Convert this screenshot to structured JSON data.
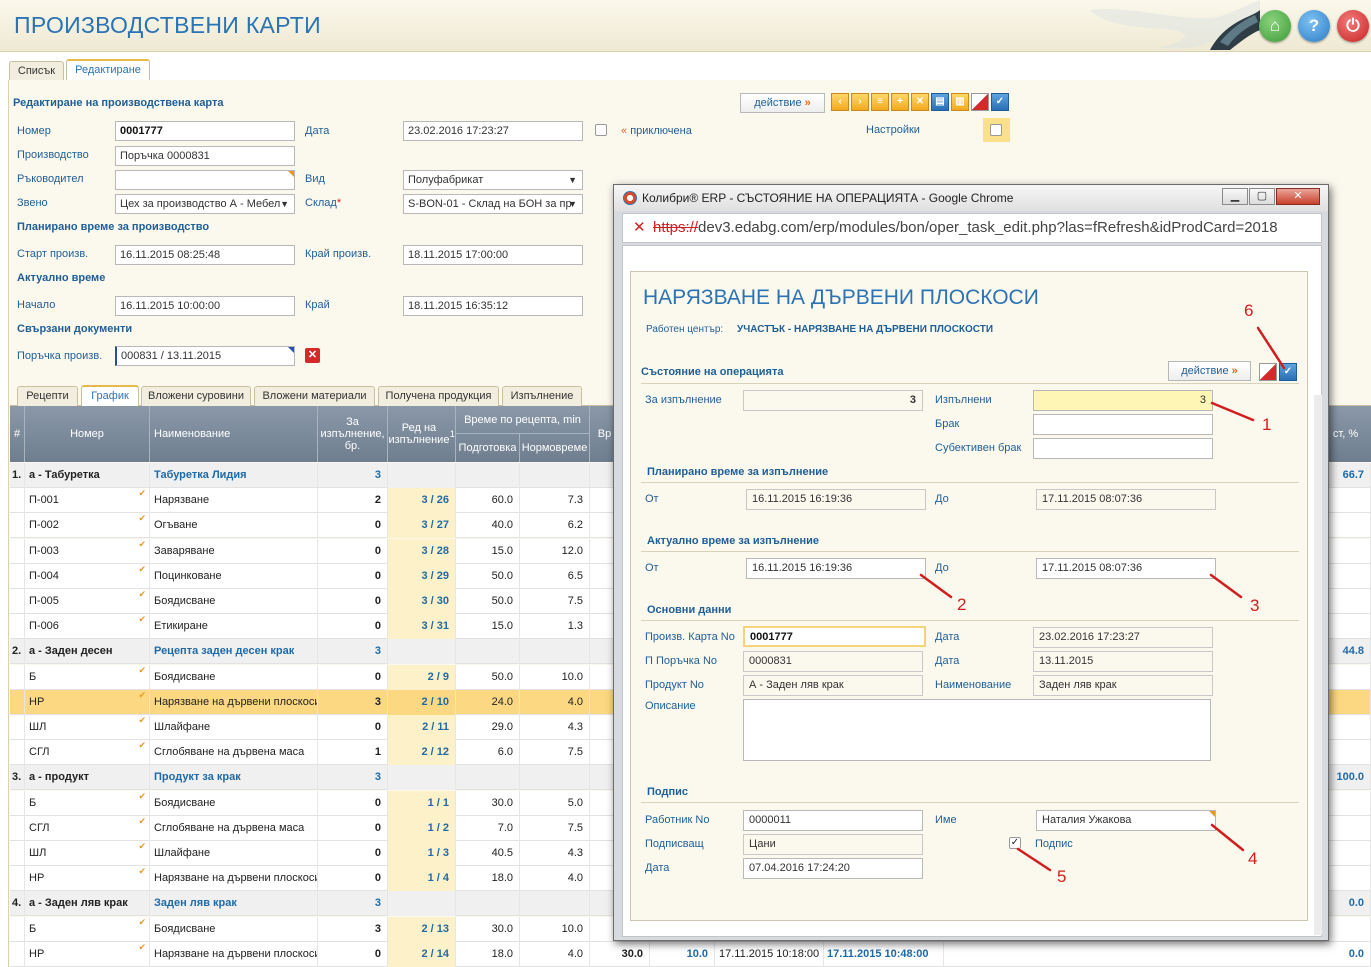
{
  "app": {
    "title": "ПРОИЗВОДСТВЕНИ КАРТИ",
    "header_buttons": [
      "home-icon",
      "help-icon",
      "power-icon"
    ]
  },
  "tabs": [
    "Списък",
    "Редактиране"
  ],
  "form": {
    "section_title": "Редактиране на производствена карта",
    "action_label": "действие",
    "number_label": "Номер",
    "number_value": "0001777",
    "date_label": "Дата",
    "date_value": "23.02.2016 17:23:27",
    "closed_label": "приключена",
    "settings_label": "Настройки",
    "production_label": "Производство",
    "production_value": "Поръчка 0000831",
    "manager_label": "Ръководител",
    "manager_value": "",
    "type_label": "Вид",
    "type_value": "Полуфабрикат",
    "unit_label": "Звено",
    "unit_value": "Цех за производство А - Мебел",
    "warehouse_label": "Склад",
    "warehouse_value": "S-BON-01 - Склад на БОН за пр",
    "planned_title": "Планирано време за производство",
    "start_label": "Старт произв.",
    "start_value": "16.11.2015 08:25:48",
    "end_label": "Край произв.",
    "end_value": "18.11.2015 17:00:00",
    "actual_title": "Актуално време",
    "begin_label": "Начало",
    "begin_value": "16.11.2015 10:00:00",
    "finish_label": "Край",
    "finish_value": "18.11.2015 16:35:12",
    "related_title": "Свързани документи",
    "order_label": "Поръчка произв.",
    "order_value": "000831 / 13.11.2015"
  },
  "subtabs": [
    "Рецепти",
    "График",
    "Вложени суровини",
    "Вложени материали",
    "Получена продукция",
    "Изпълнение"
  ],
  "grid": {
    "headers": {
      "idx": "#",
      "number": "Номер",
      "name": "Наименование",
      "qty": "За изпълнение, бр.",
      "order": "Ред на изпълнение",
      "recipe_time": "Време по рецепта, min",
      "prep": "Подготовка",
      "norm": "Нормовреме",
      "cut1": "Вр",
      "last": "ст, %"
    },
    "rows": [
      {
        "idx": "1.",
        "num": "а - Табуретка",
        "name": "Табуретка Лидия",
        "qty": "3",
        "order": "",
        "prep": "",
        "norm": "",
        "right": "66.7",
        "type": "group"
      },
      {
        "idx": "",
        "num": "П-001",
        "name": "Нарязване",
        "qty": "2",
        "order": "3 / 26",
        "prep": "60.0",
        "norm": "7.3",
        "right": "",
        "type": "item"
      },
      {
        "idx": "",
        "num": "П-002",
        "name": "Огъване",
        "qty": "0",
        "order": "3 / 27",
        "prep": "40.0",
        "norm": "6.2",
        "right": "",
        "type": "item"
      },
      {
        "idx": "",
        "num": "П-003",
        "name": "Заваряване",
        "qty": "0",
        "order": "3 / 28",
        "prep": "15.0",
        "norm": "12.0",
        "right": "",
        "type": "item"
      },
      {
        "idx": "",
        "num": "П-004",
        "name": "Поцинковане",
        "qty": "0",
        "order": "3 / 29",
        "prep": "50.0",
        "norm": "6.5",
        "right": "",
        "type": "item"
      },
      {
        "idx": "",
        "num": "П-005",
        "name": "Боядисване",
        "qty": "0",
        "order": "3 / 30",
        "prep": "50.0",
        "norm": "7.5",
        "right": "",
        "type": "item"
      },
      {
        "idx": "",
        "num": "П-006",
        "name": "Етикиране",
        "qty": "0",
        "order": "3 / 31",
        "prep": "15.0",
        "norm": "1.3",
        "right": "",
        "type": "item"
      },
      {
        "idx": "2.",
        "num": "а - Заден десен",
        "name": "Рецепта заден десен крак",
        "qty": "3",
        "order": "",
        "prep": "",
        "norm": "",
        "right": "44.8",
        "type": "group"
      },
      {
        "idx": "",
        "num": "Б",
        "name": "Боядисване",
        "qty": "0",
        "order": "2 / 9",
        "prep": "50.0",
        "norm": "10.0",
        "right": "",
        "type": "item"
      },
      {
        "idx": "",
        "num": "НР",
        "name": "Нарязване на дървени плоскоси",
        "qty": "3",
        "order": "2 / 10",
        "prep": "24.0",
        "norm": "4.0",
        "right": "",
        "type": "hl"
      },
      {
        "idx": "",
        "num": "ШЛ",
        "name": "Шлайфане",
        "qty": "0",
        "order": "2 / 11",
        "prep": "29.0",
        "norm": "4.3",
        "right": "",
        "type": "item"
      },
      {
        "idx": "",
        "num": "СГЛ",
        "name": "Сглобяване на дървена маса",
        "qty": "1",
        "order": "2 / 12",
        "prep": "6.0",
        "norm": "7.5",
        "right": "",
        "type": "item"
      },
      {
        "idx": "3.",
        "num": "а - продукт",
        "name": "Продукт за крак",
        "qty": "3",
        "order": "",
        "prep": "",
        "norm": "",
        "right": "100.0",
        "type": "group"
      },
      {
        "idx": "",
        "num": "Б",
        "name": "Боядисване",
        "qty": "0",
        "order": "1 / 1",
        "prep": "30.0",
        "norm": "5.0",
        "right": "",
        "type": "item"
      },
      {
        "idx": "",
        "num": "СГЛ",
        "name": "Сглобяване на дървена маса",
        "qty": "0",
        "order": "1 / 2",
        "prep": "7.0",
        "norm": "7.5",
        "right": "",
        "type": "item"
      },
      {
        "idx": "",
        "num": "ШЛ",
        "name": "Шлайфане",
        "qty": "0",
        "order": "1 / 3",
        "prep": "40.5",
        "norm": "4.3",
        "right": "",
        "type": "item"
      },
      {
        "idx": "",
        "num": "НР",
        "name": "Нарязване на дървени плоскоси",
        "qty": "0",
        "order": "1 / 4",
        "prep": "18.0",
        "norm": "4.0",
        "right": "",
        "type": "item"
      },
      {
        "idx": "4.",
        "num": "а - Заден ляв крак",
        "name": "Заден ляв крак",
        "qty": "3",
        "order": "",
        "prep": "",
        "norm": "",
        "right": "0.0",
        "type": "group"
      },
      {
        "idx": "",
        "num": "Б",
        "name": "Боядисване",
        "qty": "3",
        "order": "2 / 13",
        "prep": "30.0",
        "norm": "10.0",
        "right": "",
        "type": "item"
      },
      {
        "idx": "",
        "num": "НР",
        "name": "Нарязване на дървени плоскоси",
        "qty": "0",
        "order": "2 / 14",
        "prep": "18.0",
        "norm": "4.0",
        "right": "0.0",
        "type": "item"
      }
    ],
    "last_row_extra": {
      "a": "30.0",
      "b": "10.0",
      "c": "17.11.2015 10:18:00",
      "d": "17.11.2015 10:48:00"
    }
  },
  "popup": {
    "window_title": "Колибри® ERP - СЪСТОЯНИЕ НА ОПЕРАЦИЯТА - Google Chrome",
    "url_prefix": "https://",
    "url": "dev3.edabg.com/erp/modules/bon/oper_task_edit.php?las=fRefresh&idProdCard=2018",
    "heading": "НАРЯЗВАНЕ НА ДЪРВЕНИ ПЛОСКОСИ",
    "workcenter_label": "Работен център:",
    "workcenter_value": "УЧАСТЪК - НАРЯЗВАНЕ НА ДЪРВЕНИ ПЛОСКОСТИ",
    "state_title": "Състояние на операцията",
    "action_label": "действие",
    "to_do_label": "За изпълнение",
    "to_do_value": "3",
    "done_label": "Изпълнени",
    "done_value": "3",
    "scrap_label": "Брак",
    "scrap_value": "",
    "subj_scrap_label": "Субективен брак",
    "subj_scrap_value": "",
    "planned_title": "Планирано време за изпълнение",
    "from_label": "От",
    "to_label": "До",
    "planned_from": "16.11.2015 16:19:36",
    "planned_to": "17.11.2015 08:07:36",
    "actual_title": "Актуално време за изпълнение",
    "actual_from": "16.11.2015 16:19:36",
    "actual_to": "17.11.2015 08:07:36",
    "main_title": "Основни данни",
    "card_label": "Произв. Карта No",
    "card_value": "0001777",
    "date_label": "Дата",
    "card_date": "23.02.2016 17:23:27",
    "order_label": "П Поръчка No",
    "order_value": "0000831",
    "order_date": "13.11.2015",
    "product_label": "Продукт No",
    "product_value": "А - Заден ляв крак",
    "name_label": "Наименование",
    "name_value": "Заден ляв крак",
    "desc_label": "Описание",
    "sign_title": "Подпис",
    "worker_label": "Работник No",
    "worker_value": "0000011",
    "person_label": "Име",
    "person_value": "Наталия Ужакова",
    "signer_label": "Подписващ",
    "signer_value": "Цани",
    "sign_check_label": "Подпис",
    "sign_date_label": "Дата",
    "sign_date_value": "07.04.2016 17:24:20"
  },
  "annotations": [
    "1",
    "2",
    "3",
    "4",
    "5",
    "6"
  ],
  "colors": {
    "accent": "#2a74b5",
    "highlight_row": "#fcd882",
    "annotation": "#d21d1d",
    "yellow_field": "#fdf6b4"
  }
}
